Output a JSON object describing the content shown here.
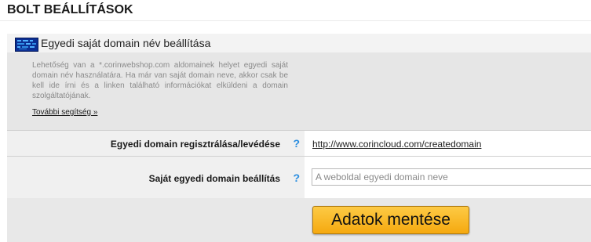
{
  "page": {
    "title": "BOLT BEÁLLÍTÁSOK"
  },
  "panel": {
    "header_title": "Egyedi saját domain név beállítása",
    "header_icon": "monitor-screen-icon",
    "info_text": "Lehetőség van a *.corinwebshop.com aldomainek helyet egyedi saját domain név használatára. Ha már van saját domain neve, akkor csak be kell ide írni és a linken található információkat elküldeni a domain szolgáltatójának.",
    "help_link": "További segítség »"
  },
  "rows": [
    {
      "label": "Egyedi domain regisztrálása/levédése",
      "help_icon": "?",
      "link": "http://www.corincloud.com/createdomain"
    },
    {
      "label": "Saját egyedi domain beállítás",
      "help_icon": "?",
      "input_value": "",
      "input_placeholder": "A weboldal egyedi domain neve"
    }
  ],
  "actions": {
    "save_label": "Adatok mentése"
  },
  "colors": {
    "accent_button": "#f7b21c",
    "help_icon": "#2a8de0",
    "header_icon_bg": "#0b2f93"
  }
}
